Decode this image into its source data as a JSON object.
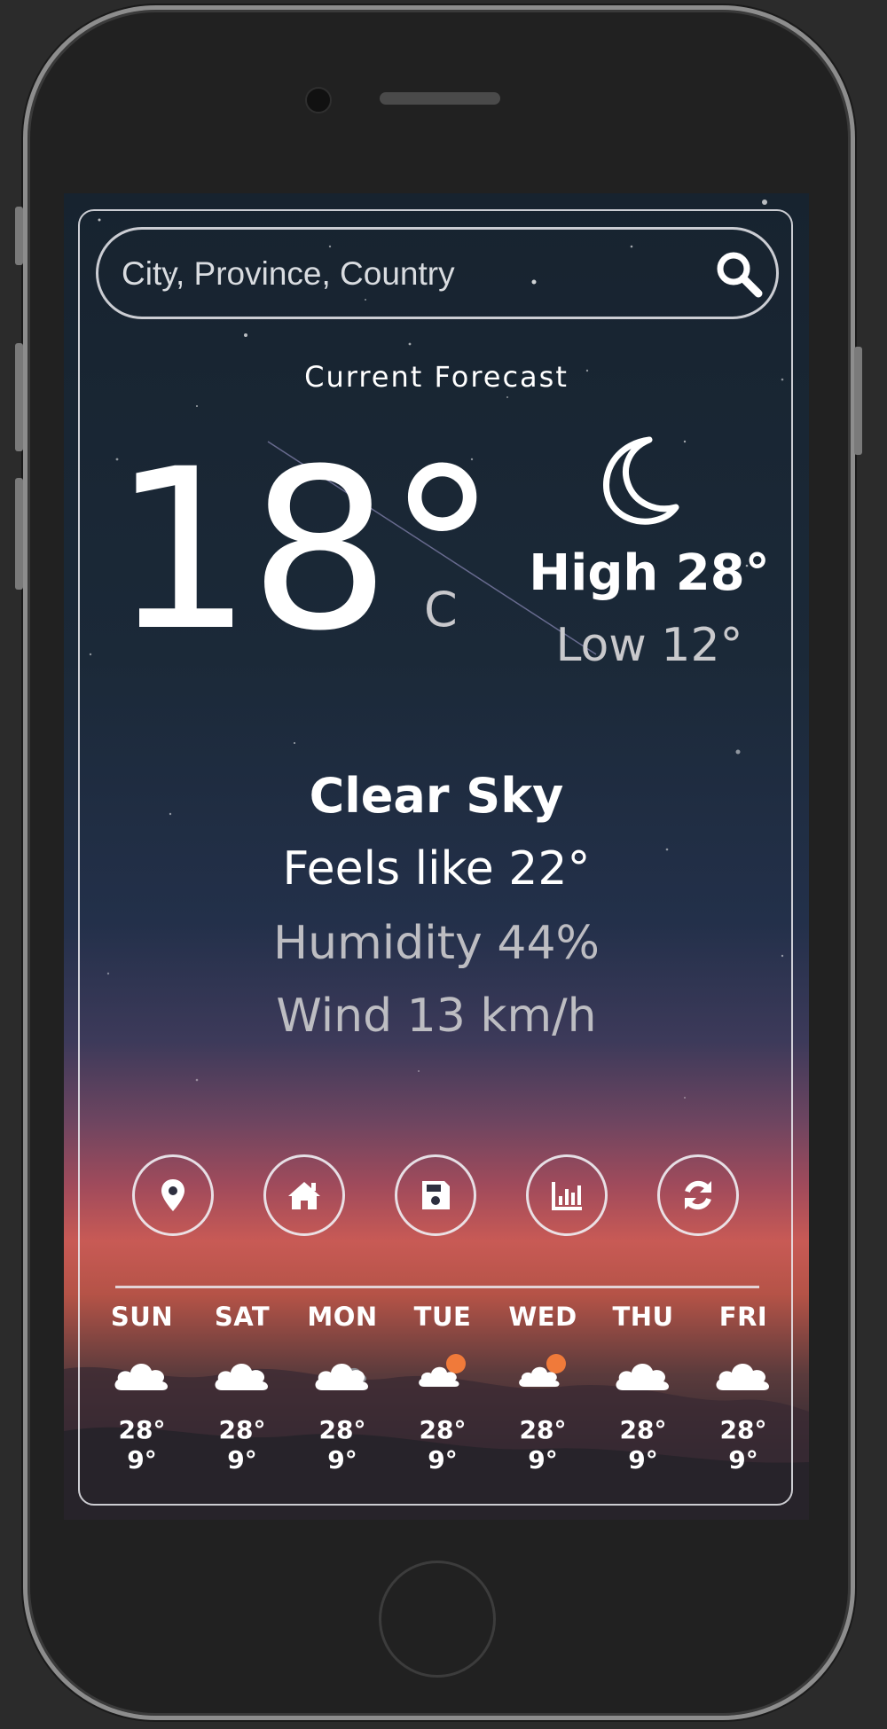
{
  "search": {
    "placeholder": "City, Province, Country",
    "icon": "search-icon"
  },
  "current": {
    "label": "Current Forecast",
    "temperature": "18°",
    "unit": "C",
    "icon": "moon-icon",
    "high": "High 28°",
    "low": "Low 12°",
    "condition": "Clear Sky",
    "feels_like": "Feels like 22°",
    "humidity": "Humidity 44%",
    "wind": "Wind 13 km/h"
  },
  "actions": [
    {
      "icon": "location-pin-icon"
    },
    {
      "icon": "home-icon"
    },
    {
      "icon": "save-icon"
    },
    {
      "icon": "chart-icon"
    },
    {
      "icon": "refresh-icon"
    }
  ],
  "forecast": [
    {
      "day": "SUN",
      "high": "28°",
      "low": "9°",
      "icon": "cloud-icon"
    },
    {
      "day": "SAT",
      "high": "28°",
      "low": "9°",
      "icon": "cloud-icon"
    },
    {
      "day": "MON",
      "high": "28°",
      "low": "9°",
      "icon": "cloud-icon"
    },
    {
      "day": "TUE",
      "high": "28°",
      "low": "9°",
      "icon": "cloud-sun-icon"
    },
    {
      "day": "WED",
      "high": "28°",
      "low": "9°",
      "icon": "cloud-sun-icon"
    },
    {
      "day": "THU",
      "high": "28°",
      "low": "9°",
      "icon": "cloud-icon"
    },
    {
      "day": "FRI",
      "high": "28°",
      "low": "9°",
      "icon": "cloud-icon"
    }
  ],
  "colors": {
    "text": "#ffffff",
    "muted": "#bdbdc2",
    "frame": "#ebebf0",
    "sun": "#f07a3a"
  }
}
